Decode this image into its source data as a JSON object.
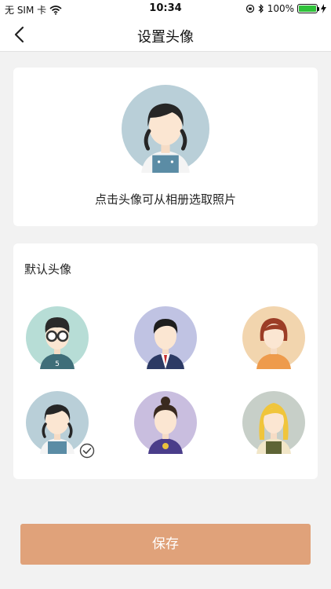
{
  "status_bar": {
    "carrier": "无 SIM 卡",
    "time": "10:34",
    "battery": "100%",
    "battery_level": 1.0
  },
  "nav": {
    "title": "设置头像"
  },
  "current": {
    "hint": "点击头像可从相册选取照片",
    "avatar_icon": "girl-pigtails-avatar-icon"
  },
  "defaults": {
    "title": "默认头像",
    "avatars": [
      {
        "icon": "boy-glasses-avatar-icon",
        "selected": false
      },
      {
        "icon": "man-suit-avatar-icon",
        "selected": false
      },
      {
        "icon": "woman-bob-avatar-icon",
        "selected": false
      },
      {
        "icon": "girl-pigtails-avatar-icon",
        "selected": true
      },
      {
        "icon": "woman-bun-avatar-icon",
        "selected": false
      },
      {
        "icon": "girl-blonde-avatar-icon",
        "selected": false
      }
    ]
  },
  "save_label": "保存",
  "colors": {
    "save_button": "#e0a27a",
    "background": "#f2f2f2"
  }
}
